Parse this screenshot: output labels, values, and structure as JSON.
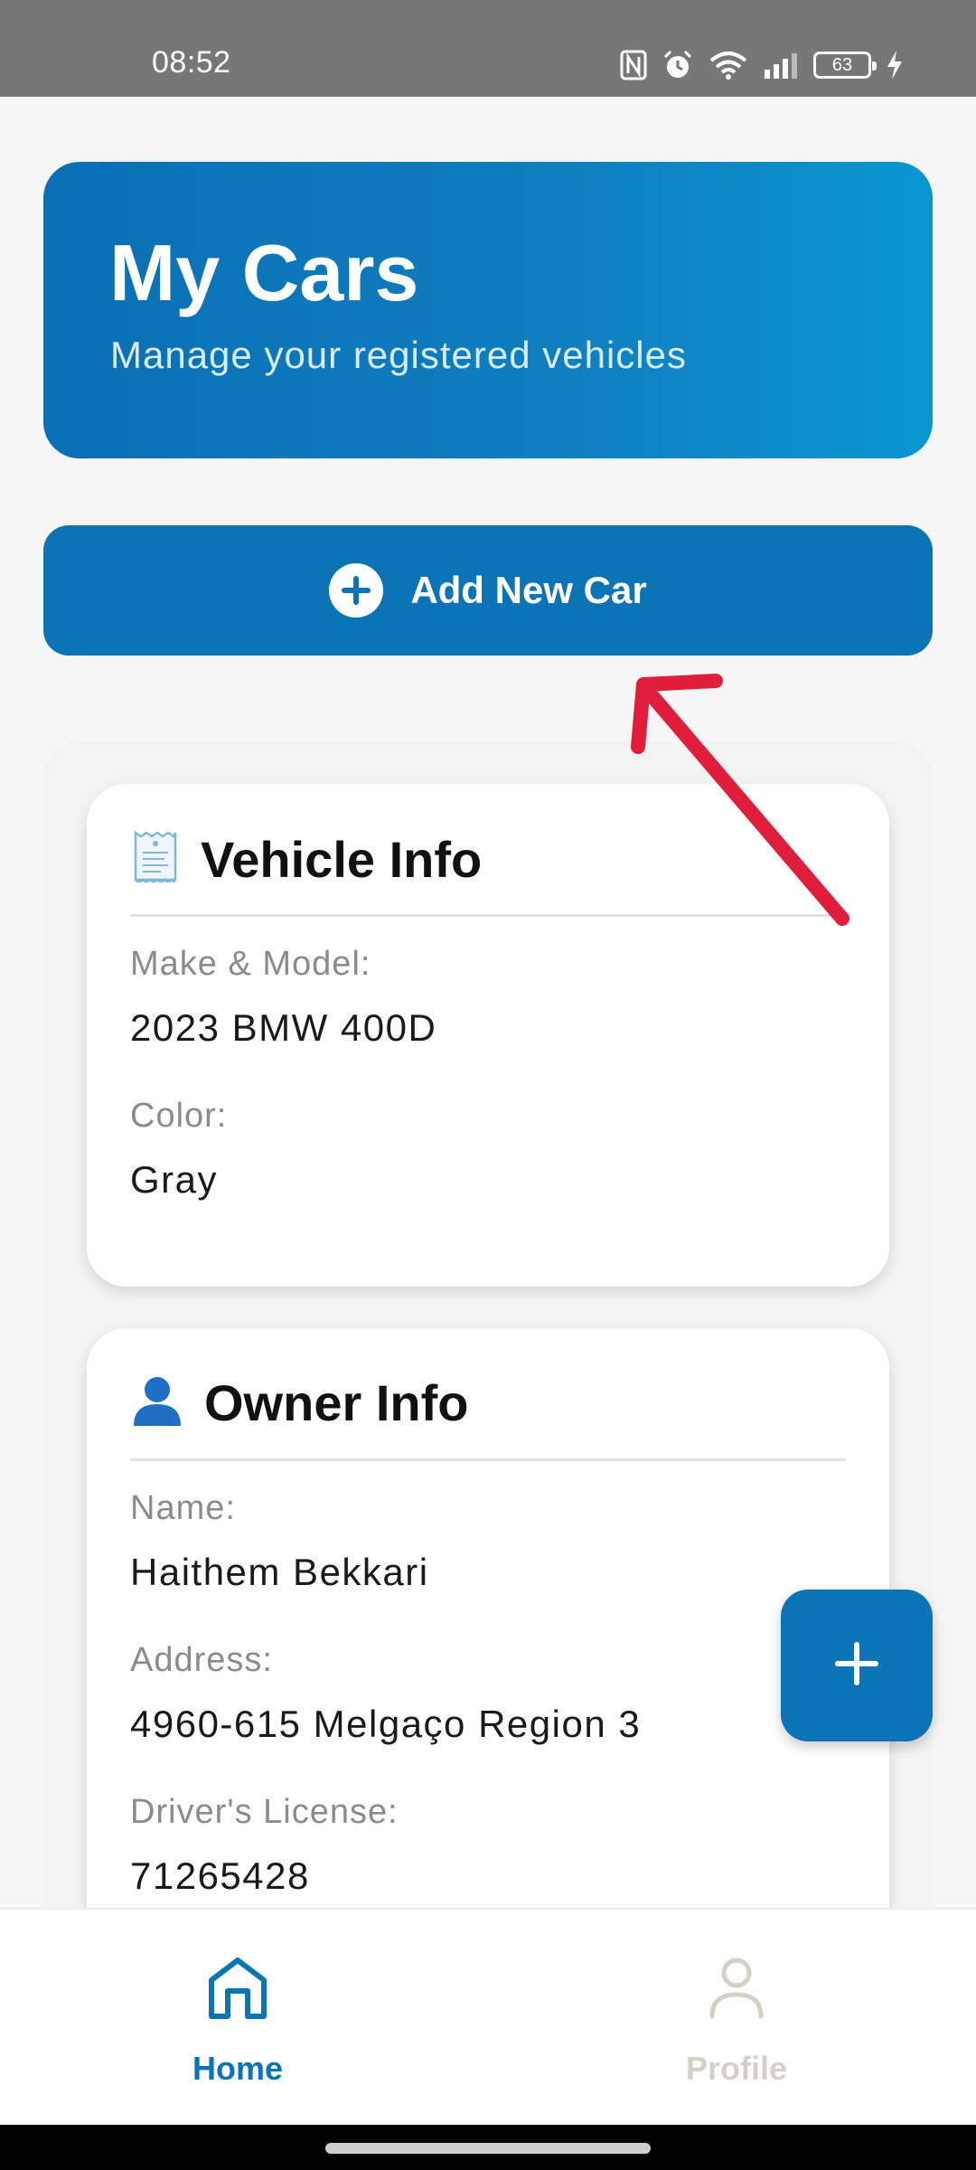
{
  "status_bar": {
    "time": "08:52",
    "battery": "63",
    "icons": [
      "nfc-icon",
      "alarm-icon",
      "wifi-icon",
      "signal-icon",
      "battery-icon",
      "charging-icon"
    ]
  },
  "header": {
    "title": "My Cars",
    "subtitle": "Manage your registered vehicles"
  },
  "add_car_button": {
    "label": "Add New Car",
    "icon": "plus-circle-icon"
  },
  "vehicle_card": {
    "icon": "receipt-icon",
    "title": "Vehicle Info",
    "fields": [
      {
        "label": "Make & Model:",
        "value": "2023 BMW 400D"
      },
      {
        "label": "Color:",
        "value": "Gray"
      }
    ]
  },
  "owner_card": {
    "icon": "person-icon",
    "title": "Owner Info",
    "fields": [
      {
        "label": "Name:",
        "value": "Haithem Bekkari"
      },
      {
        "label": "Address:",
        "value": "4960-615 Melgaço Region 3"
      },
      {
        "label": "Driver's License:",
        "value": "71265428"
      }
    ]
  },
  "fab": {
    "icon": "plus-icon"
  },
  "bottom_nav": {
    "items": [
      {
        "label": "Home",
        "icon": "home-icon",
        "active": true
      },
      {
        "label": "Profile",
        "icon": "profile-icon",
        "active": false
      }
    ]
  },
  "colors": {
    "primary": "#0a74b7",
    "header_gradient_end": "#0a97cf",
    "annotation_arrow": "#e11d3c",
    "inactive_nav": "#d8cfc4"
  }
}
